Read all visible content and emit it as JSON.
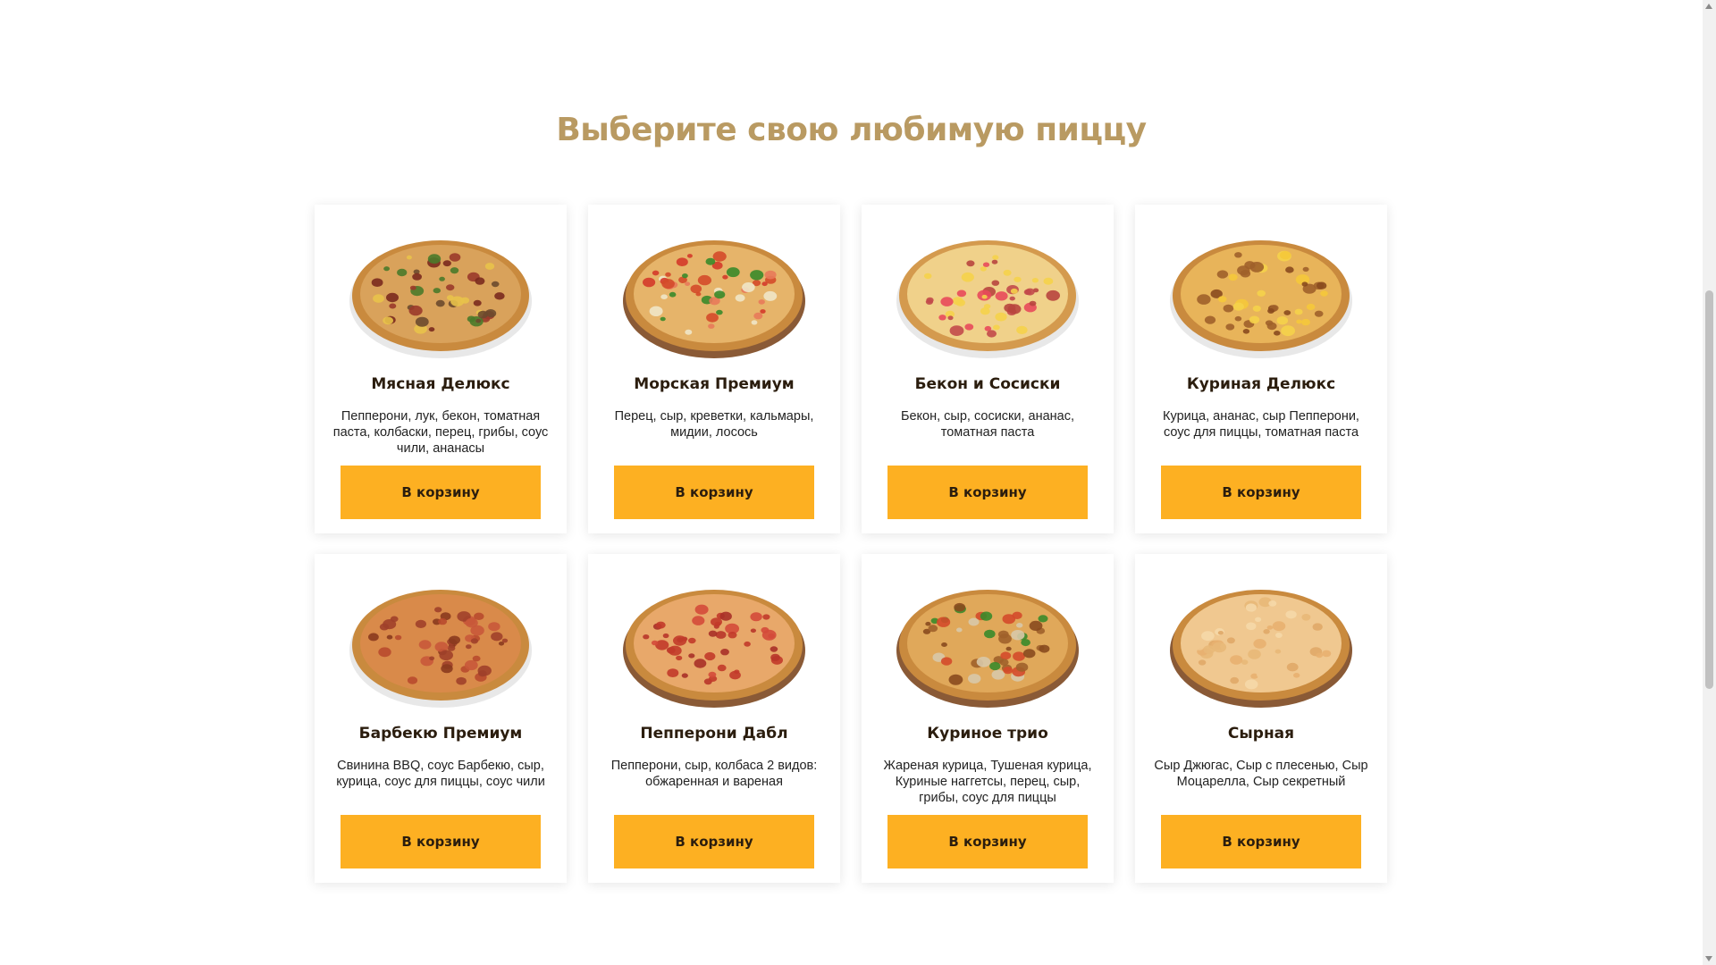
{
  "section": {
    "title": "Выберите свою любимую пиццу"
  },
  "colors": {
    "title": "#b99a62",
    "button": "#fdb022",
    "text_dark": "#2b1d0e"
  },
  "pizzas": [
    {
      "name": "Мясная Делюкс",
      "description": "Пепперони, лук, бекон, томатная паста, колбаски, перец, грибы, соус чили, ананасы",
      "button": "В корзину",
      "image": "pizza-meat-deluxe-image",
      "style": {
        "crust": "#c98a3e",
        "cheese": "#d9a25b",
        "plate": "#e8e8e8",
        "toppings": [
          "#7a2a1e",
          "#4a7a2a",
          "#6b4a2e",
          "#e8c24a",
          "#9a3a2a"
        ]
      }
    },
    {
      "name": "Морская Премиум",
      "description": "Перец, сыр, креветки, кальмары, мидии, лосось",
      "button": "В корзину",
      "image": "pizza-seafood-premium-image",
      "style": {
        "crust": "#c98a3e",
        "cheese": "#e6b46a",
        "plate": "#8a5a36",
        "toppings": [
          "#d44a2a",
          "#3a8a2a",
          "#f0e6c8",
          "#e87a5a",
          "#d43a2a"
        ]
      }
    },
    {
      "name": "Бекон и Сосиски",
      "description": "Бекон, сыр, сосиски, ананас, томатная паста",
      "button": "В корзину",
      "image": "pizza-bacon-sausage-image",
      "style": {
        "crust": "#d49a4e",
        "cheese": "#f0d18a",
        "plate": "#e8e8e8",
        "toppings": [
          "#c24a4a",
          "#e84a5a",
          "#f5d24a",
          "#b8453e",
          "#f5d24a"
        ]
      }
    },
    {
      "name": "Куриная Делюкс",
      "description": "Курица, ананас, сыр Пепперони, соус для пиццы, томатная паста",
      "button": "В корзину",
      "image": "pizza-chicken-deluxe-image",
      "style": {
        "crust": "#c98a3e",
        "cheese": "#e8b45a",
        "plate": "#e8e8e8",
        "toppings": [
          "#a0602a",
          "#f5d24a",
          "#8a4a1e",
          "#f5c83a",
          "#a0602a"
        ]
      }
    },
    {
      "name": "Барбекю Премиум",
      "description": "Свинина BBQ, соус Барбекю, сыр, курица, соус для пиццы, соус чили",
      "button": "В корзину",
      "image": "pizza-bbq-premium-image",
      "style": {
        "crust": "#c98a3e",
        "cheese": "#d98a4a",
        "plate": "#e8e8e8",
        "toppings": [
          "#a0402a",
          "#b84a2e",
          "#8a3a1e",
          "#c8583a",
          "#a0402a"
        ]
      }
    },
    {
      "name": "Пепперони Дабл",
      "description": "Пепперони, сыр, колбаса 2 видов: обжаренная и вареная",
      "button": "В корзину",
      "image": "pizza-pepperoni-double-image",
      "style": {
        "crust": "#c98a3e",
        "cheese": "#e8a86a",
        "plate": "#8a5a36",
        "toppings": [
          "#c23a2a",
          "#b8352a",
          "#d44a3a",
          "#a83028",
          "#c23a2a"
        ]
      }
    },
    {
      "name": "Куриное трио",
      "description": "Жареная курица, Тушеная курица, Куриные наггетсы, перец, сыр, грибы, соус для пиццы",
      "button": "В корзину",
      "image": "pizza-chicken-trio-image",
      "style": {
        "crust": "#c98a3e",
        "cheese": "#e0a85a",
        "plate": "#8a5a36",
        "toppings": [
          "#a0602a",
          "#3a8a2a",
          "#d8c8a8",
          "#d44a2a",
          "#8a4a1e"
        ]
      }
    },
    {
      "name": "Сырная",
      "description": "Сыр Джюгас, Сыр с плесенью, Сыр Моцарелла, Сыр секретный",
      "button": "В корзину",
      "image": "pizza-cheese-image",
      "style": {
        "crust": "#c98a3e",
        "cheese": "#f0c890",
        "plate": "#8a5a36",
        "toppings": [
          "#e8b070",
          "#f5d8a8",
          "#e0a868",
          "#f0c890",
          "#e8b878"
        ]
      }
    }
  ]
}
